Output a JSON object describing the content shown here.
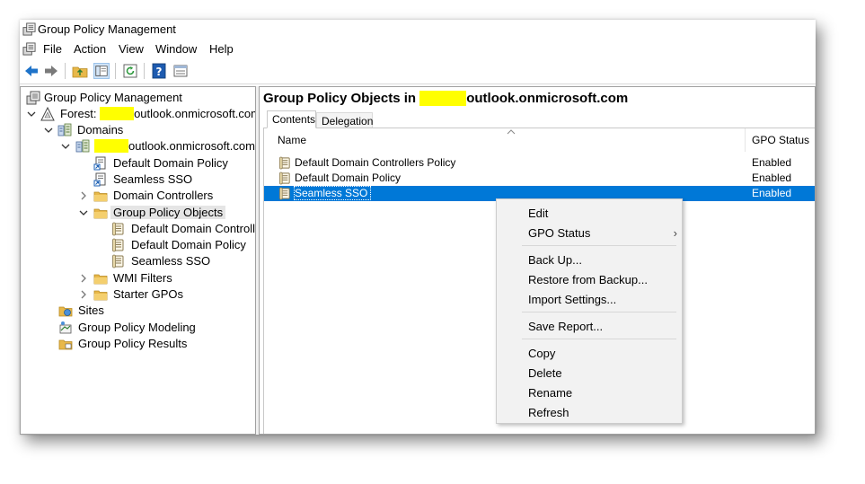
{
  "window": {
    "title": "Group Policy Management"
  },
  "menu": [
    "File",
    "Action",
    "View",
    "Window",
    "Help"
  ],
  "tree": {
    "root": "Group Policy Management",
    "forest_prefix": "Forest: ",
    "forest_suffix": "outlook.onmicrosoft.com",
    "domains": "Domains",
    "domain_suffix": "outlook.onmicrosoft.com",
    "default_domain_policy": "Default Domain Policy",
    "seamless_sso": "Seamless SSO",
    "domain_controllers": "Domain Controllers",
    "gpo_folder": "Group Policy Objects",
    "gpo_children": [
      "Default Domain Controllers Policy",
      "Default Domain Policy",
      "Seamless SSO"
    ],
    "wmi_filters": "WMI Filters",
    "starter_gpos": "Starter GPOs",
    "sites": "Sites",
    "modeling": "Group Policy Modeling",
    "results": "Group Policy Results"
  },
  "right": {
    "title_prefix": "Group Policy Objects in ",
    "title_suffix": "outlook.onmicrosoft.com",
    "tabs": [
      "Contents",
      "Delegation"
    ],
    "columns": [
      "Name",
      "GPO Status"
    ],
    "rows": [
      {
        "name": "Default Domain Controllers Policy",
        "status": "Enabled"
      },
      {
        "name": "Default Domain Policy",
        "status": "Enabled"
      },
      {
        "name": "Seamless SSO",
        "status": "Enabled"
      }
    ]
  },
  "context_menu": {
    "items": [
      "Edit",
      "GPO Status",
      "Back Up...",
      "Restore from Backup...",
      "Import Settings...",
      "Save Report...",
      "Copy",
      "Delete",
      "Rename",
      "Refresh"
    ],
    "submenu_arrow": "›"
  },
  "colors": {
    "selection": "#0078d7",
    "redaction": "#ffff00",
    "folder": "#e8b84a"
  }
}
